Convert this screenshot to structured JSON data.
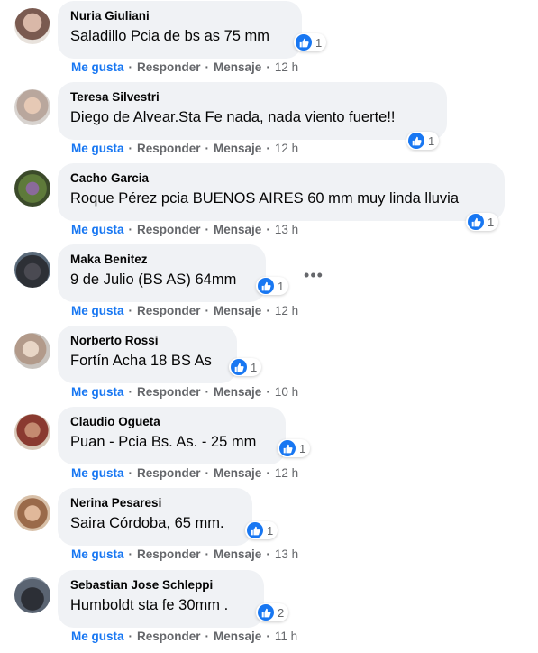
{
  "actions": {
    "like": "Me gusta",
    "reply": "Responder",
    "message": "Mensaje",
    "separator": "·"
  },
  "colors": {
    "like_blue": "#1877f2",
    "bubble_bg": "#f0f2f5",
    "meta_gray": "#65676b"
  },
  "more_icon": "more-horizontal-icon",
  "comments": [
    {
      "author": "Nuria Giuliani",
      "text": "Saladillo Pcia de bs as 75 mm",
      "reactions": "1",
      "time": "12 h"
    },
    {
      "author": "Teresa Silvestri",
      "text": "Diego de Alvear.Sta Fe nada, nada viento fuerte!!",
      "reactions": "1",
      "time": "12 h"
    },
    {
      "author": "Cacho Garcia",
      "text": "Roque Pérez pcia BUENOS AIRES 60 mm muy linda lluvia",
      "reactions": "1",
      "time": "13 h"
    },
    {
      "author": "Maka Benitez",
      "text": "9 de Julio (BS AS) 64mm",
      "reactions": "1",
      "time": "12 h"
    },
    {
      "author": "Norberto Rossi",
      "text": "Fortín Acha 18 BS As",
      "reactions": "1",
      "time": "10 h"
    },
    {
      "author": "Claudio Ogueta",
      "text": "Puan - Pcia Bs. As. - 25 mm",
      "reactions": "1",
      "time": "12 h"
    },
    {
      "author": "Nerina Pesaresi",
      "text": "Saira Córdoba, 65 mm.",
      "reactions": "1",
      "time": "13 h"
    },
    {
      "author": "Sebastian Jose Schleppi",
      "text": "Humboldt sta fe 30mm .",
      "reactions": "2",
      "time": "11 h"
    }
  ]
}
